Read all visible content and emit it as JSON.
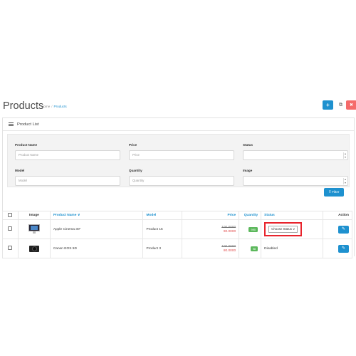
{
  "header": {
    "title": "Products",
    "breadcrumb": {
      "home": "Home",
      "separator": "/",
      "current": "Products"
    },
    "buttons": {
      "add": "+",
      "copy": "⧉",
      "delete": "✖"
    }
  },
  "panel": {
    "title": "Product List",
    "filter": {
      "product_name": {
        "label": "Product Name",
        "placeholder": "Product Name"
      },
      "price": {
        "label": "Price",
        "placeholder": "Price"
      },
      "status": {
        "label": "Status",
        "value": ""
      },
      "model": {
        "label": "Model",
        "placeholder": "Model"
      },
      "quantity": {
        "label": "Quantity",
        "placeholder": "Quantity"
      },
      "image": {
        "label": "Image",
        "value": ""
      },
      "filter_button": "⊽ Filter"
    }
  },
  "table": {
    "columns": {
      "image": "Image",
      "product_name": "Product Name ∨",
      "model": "Model",
      "price": "Price",
      "quantity": "Quantity",
      "status": "Status",
      "action": "Action"
    },
    "rows": [
      {
        "name": "Apple Cinema 30\"",
        "model": "Product 15",
        "price_old": "100.0000",
        "price_new": "90.0000",
        "quantity": "990",
        "status": "Choose Status ∨",
        "image": "monitor-thumbnail"
      },
      {
        "name": "Canon EOS 5D",
        "model": "Product 3",
        "price_old": "100.0000",
        "price_new": "80.0000",
        "quantity": "98",
        "status": "Disabled",
        "image": "camera-thumbnail"
      }
    ]
  },
  "colors": {
    "primary": "#1e91cf",
    "danger": "#f56b6b",
    "success": "#5cb85c",
    "highlight": "#e8232c"
  }
}
